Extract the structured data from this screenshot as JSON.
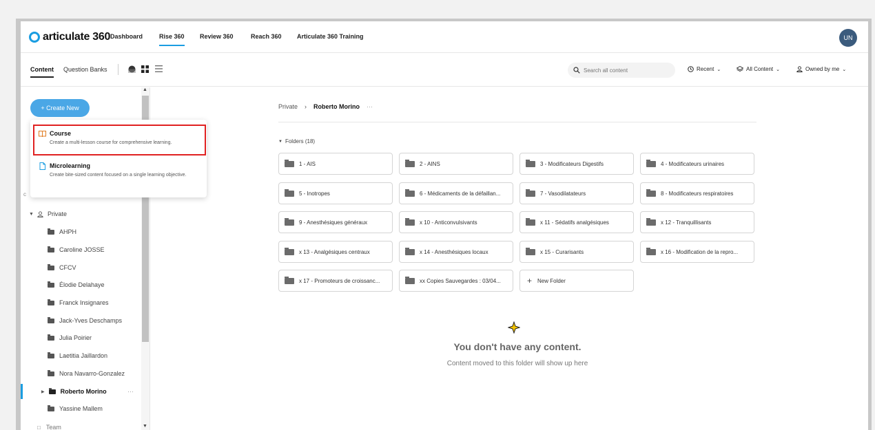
{
  "app": {
    "logo_text": "articulate 360",
    "nav": [
      "Dashboard",
      "Rise 360",
      "Review 360",
      "Reach 360",
      "Articulate 360 Training"
    ],
    "active_nav": "Rise 360",
    "user_initials": "UN"
  },
  "subnav": {
    "tabs": [
      "Content",
      "Question Banks"
    ],
    "search_placeholder": "Search all content",
    "filters": [
      "Recent",
      "All Content",
      "Owned by me"
    ]
  },
  "sidebar": {
    "create_label": "+ Create New",
    "private_label": "Private",
    "team_label": "Team",
    "folders": [
      "AHPH",
      "Caroline JOSSE",
      "CFCV",
      "Élodie Delahaye",
      "Franck Insignares",
      "Jack-Yves Deschamps",
      "Julia Poirier",
      "Laetitia Jaillardon",
      "Nora Navarro-Gonzalez",
      "Roberto Morino",
      "Yassine Mallem"
    ],
    "selected": "Roberto Morino"
  },
  "dropdown": {
    "items": [
      {
        "title": "Course",
        "desc": "Create a multi-lesson course for comprehensive learning."
      },
      {
        "title": "Microlearning",
        "desc": "Create bite-sized content focused on a single learning objective."
      }
    ]
  },
  "main": {
    "breadcrumb": [
      "Private",
      "Roberto Morino"
    ],
    "folders_header": "Folders (18)",
    "folders": [
      "1 - AIS",
      "2 - AINS",
      "3 - Modificateurs Digestifs",
      "4 - Modificateurs urinaires",
      "5 - Inotropes",
      "6 - Médicaments de la défaillan...",
      "7 - Vasodilatateurs",
      "8 - Modificateurs respiratoires",
      "9 - Anesthésiques généraux",
      "x 10 - Anticonvulsivants",
      "x 11 - Sédatifs analgésiques",
      "x 12 - Tranquillisants",
      "x 13 - Analgésiques centraux",
      "x 14 - Anesthésiques locaux",
      "x 15 - Curarisants",
      "x 16 - Modification de la repro...",
      "x 17 - Promoteurs de croissanc...",
      "xx Copies Sauvegardes : 03/04..."
    ],
    "new_folder": "New Folder",
    "empty_title": "You don't have any content.",
    "empty_sub": "Content moved to this folder will show up here"
  },
  "colors": {
    "accent": "#1a9de1",
    "create_button": "#4aa7e6",
    "highlight": "#e02020",
    "avatar": "#3b5b7d"
  }
}
